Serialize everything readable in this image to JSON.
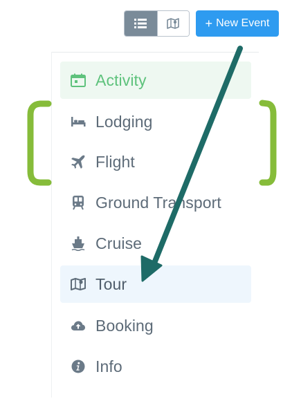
{
  "toolbar": {
    "list_view_icon": "list-icon",
    "map_view_icon": "map-icon",
    "new_event_plus": "+",
    "new_event_label": "New Event",
    "colors": {
      "primary": "#2e9bf0",
      "toggle_active": "#7a8b99"
    }
  },
  "menu": {
    "items": [
      {
        "label": "Activity",
        "icon": "calendar-icon",
        "state": "selected"
      },
      {
        "label": "Lodging",
        "icon": "bed-icon",
        "state": "normal"
      },
      {
        "label": "Flight",
        "icon": "airplane-icon",
        "state": "normal"
      },
      {
        "label": "Ground Transport",
        "icon": "train-icon",
        "state": "normal"
      },
      {
        "label": "Cruise",
        "icon": "ship-icon",
        "state": "normal"
      },
      {
        "label": "Tour",
        "icon": "map-icon",
        "state": "highlighted"
      },
      {
        "label": "Booking",
        "icon": "cloud-upload-icon",
        "state": "normal"
      },
      {
        "label": "Info",
        "icon": "info-icon",
        "state": "normal"
      }
    ],
    "colors": {
      "selected_text": "#5ec27c",
      "selected_bg": "#eef8f1",
      "highlight_bg": "#eef6fd",
      "text": "#5d6b78"
    }
  },
  "annotation": {
    "bracket_color": "#86bc3a",
    "arrow_color": "#1e6b67"
  }
}
